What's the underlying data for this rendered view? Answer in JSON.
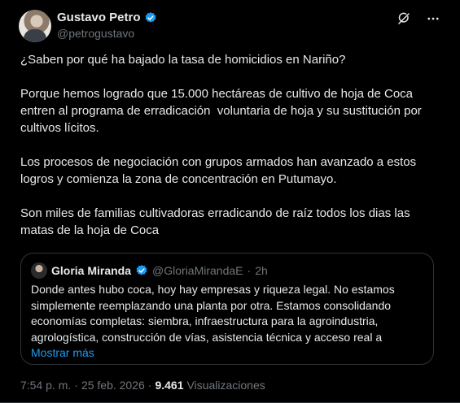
{
  "author": {
    "display_name": "Gustavo Petro",
    "handle": "@petrogustavo",
    "verified": true,
    "avatar": "avatar-image"
  },
  "top_actions": {
    "grok_icon": "grok-icon",
    "more_icon": "more-horizontal-icon"
  },
  "tweet": {
    "paragraphs": [
      "¿Saben por qué ha bajado la tasa de homicidios en Nariño?",
      "Porque hemos logrado que 15.000 hectáreas de cultivo de hoja de Coca entren al programa de erradicación  voluntaria de hoja y su sustitución por cultivos lícitos.",
      "Los procesos de negociación con grupos armados han avanzado a estos logros y comienza la zona de concentración en Putumayo.",
      "Son miles de familias cultivadoras erradicando de raíz todos los dias las matas de la hoja de Coca"
    ]
  },
  "quote": {
    "display_name": "Gloria Miranda",
    "handle": "@GloriaMirandaE",
    "separator": "·",
    "time": "2h",
    "verified": true,
    "text": "Donde antes hubo coca, hoy hay empresas y riqueza legal. No estamos simplemente reemplazando una planta por otra. Estamos consolidando economías completas: siembra, infraestructura para la agroindustria, agrologística, construcción de vías, asistencia técnica y acceso real a",
    "show_more": "Mostrar más"
  },
  "footer": {
    "time": "7:54 p. m.",
    "separator1": "·",
    "date": "25 feb. 2026",
    "separator2": "·",
    "views_count": "9.461",
    "views_label": "Visualizaciones"
  },
  "colors": {
    "background": "#000000",
    "text": "#e7e9ea",
    "muted": "#71767b",
    "accent": "#1d9bf0",
    "border": "#2f3336"
  }
}
